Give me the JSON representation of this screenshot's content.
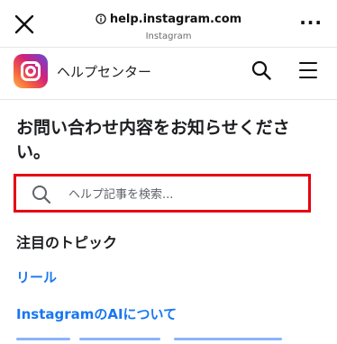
{
  "browser": {
    "url": "help.instagram.com",
    "site_name": "Instagram",
    "more_label": "···"
  },
  "header": {
    "title": "ヘルプセンター"
  },
  "main": {
    "headline": "お問い合わせ内容をお知らせください。",
    "search": {
      "placeholder": "ヘルプ記事を検索...",
      "highlight_color": "#e60012"
    },
    "topics_heading": "注目のトピック",
    "topics": [
      {
        "label": "リール"
      },
      {
        "label": "InstagramのAIについて"
      }
    ]
  },
  "colors": {
    "link": "#1877f2",
    "text": "#1c1e21"
  }
}
